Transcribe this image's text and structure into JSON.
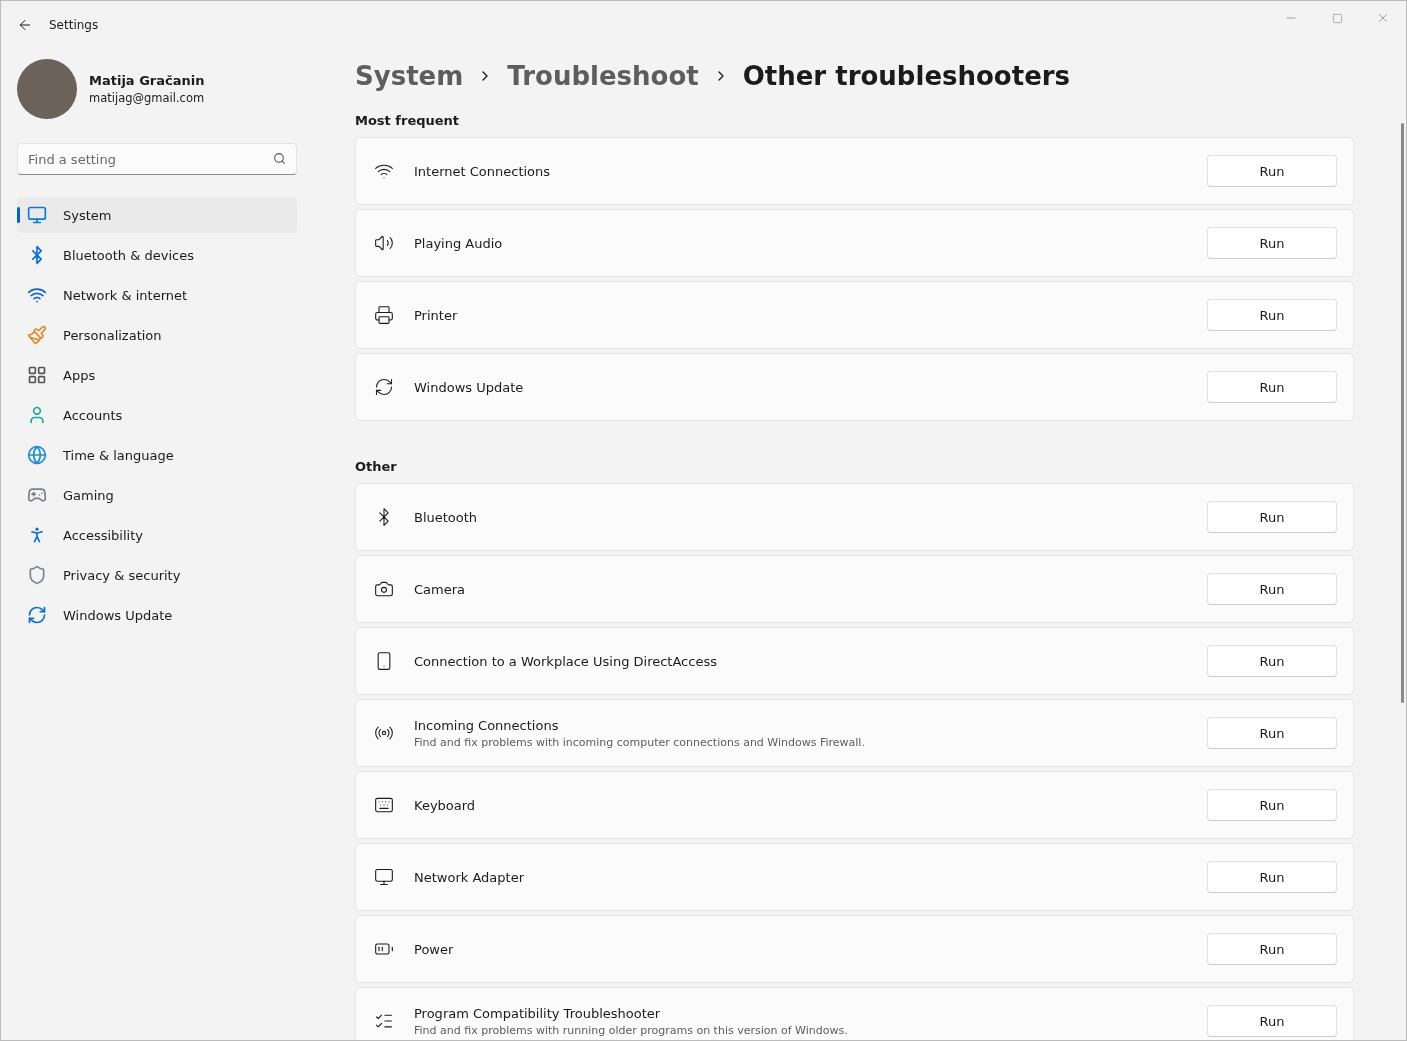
{
  "window": {
    "title": "Settings"
  },
  "profile": {
    "name": "Matija Gračanin",
    "email": "matijag@gmail.com"
  },
  "search": {
    "placeholder": "Find a setting"
  },
  "nav": [
    {
      "label": "System",
      "selected": true
    },
    {
      "label": "Bluetooth & devices",
      "selected": false
    },
    {
      "label": "Network & internet",
      "selected": false
    },
    {
      "label": "Personalization",
      "selected": false
    },
    {
      "label": "Apps",
      "selected": false
    },
    {
      "label": "Accounts",
      "selected": false
    },
    {
      "label": "Time & language",
      "selected": false
    },
    {
      "label": "Gaming",
      "selected": false
    },
    {
      "label": "Accessibility",
      "selected": false
    },
    {
      "label": "Privacy & security",
      "selected": false
    },
    {
      "label": "Windows Update",
      "selected": false
    }
  ],
  "breadcrumb": [
    "System",
    "Troubleshoot",
    "Other troubleshooters"
  ],
  "sections": [
    {
      "title": "Most frequent",
      "items": [
        {
          "name": "Internet Connections",
          "button": "Run"
        },
        {
          "name": "Playing Audio",
          "button": "Run"
        },
        {
          "name": "Printer",
          "button": "Run"
        },
        {
          "name": "Windows Update",
          "button": "Run"
        }
      ]
    },
    {
      "title": "Other",
      "items": [
        {
          "name": "Bluetooth",
          "button": "Run"
        },
        {
          "name": "Camera",
          "button": "Run"
        },
        {
          "name": "Connection to a Workplace Using DirectAccess",
          "button": "Run"
        },
        {
          "name": "Incoming Connections",
          "description": "Find and fix problems with incoming computer connections and Windows Firewall.",
          "button": "Run"
        },
        {
          "name": "Keyboard",
          "button": "Run"
        },
        {
          "name": "Network Adapter",
          "button": "Run"
        },
        {
          "name": "Power",
          "button": "Run"
        },
        {
          "name": "Program Compatibility Troubleshooter",
          "description": "Find and fix problems with running older programs on this version of Windows.",
          "button": "Run"
        }
      ]
    }
  ]
}
